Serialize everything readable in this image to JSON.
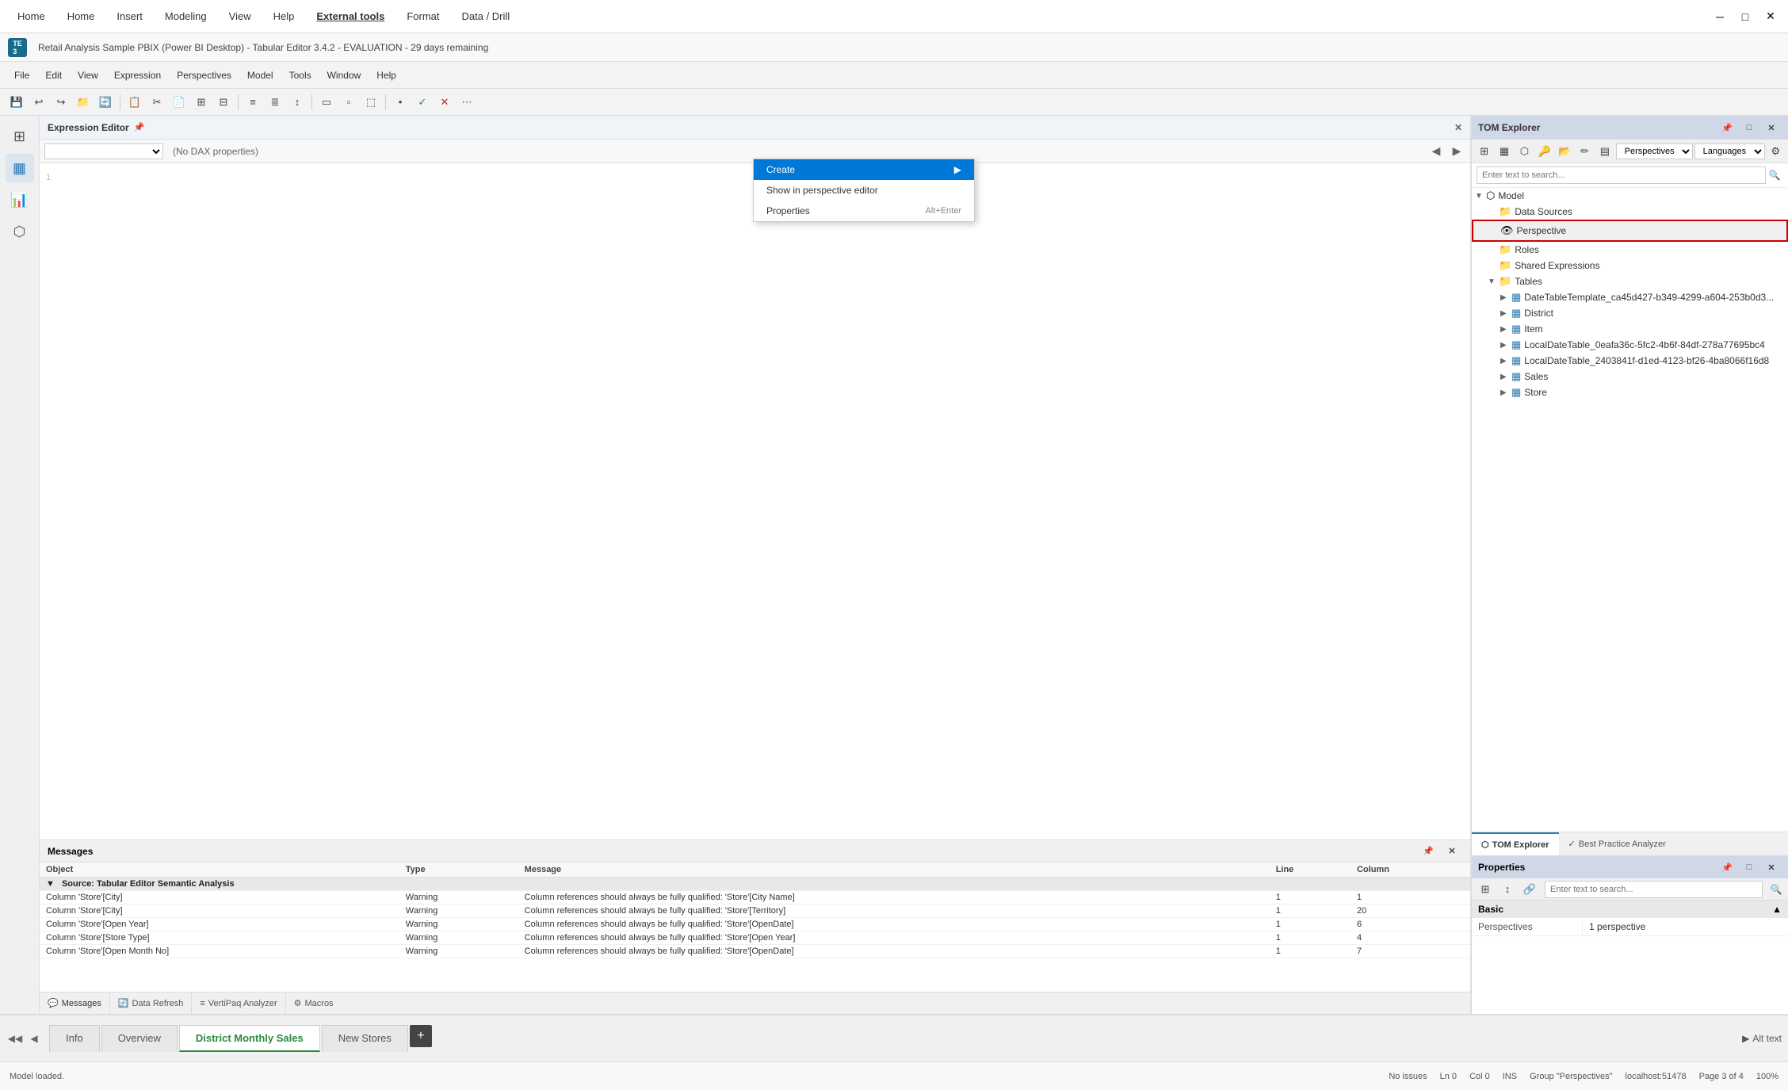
{
  "app": {
    "title": "Retail Analysis Sample PBIX (Power BI Desktop) - Tabular Editor 3.4.2 - EVALUATION - 29 days remaining",
    "tab_label": "Tabular Editor 3"
  },
  "powerbi_menu": {
    "items": [
      "Home",
      "Insert",
      "Modeling",
      "View",
      "Help",
      "External tools",
      "Format",
      "Data / Drill"
    ]
  },
  "tabular_menu": {
    "items": [
      "File",
      "Edit",
      "View",
      "Expression",
      "Perspectives",
      "Model",
      "Tools",
      "Window",
      "Help"
    ]
  },
  "expression_editor": {
    "title": "Expression Editor",
    "placeholder": "(No DAX properties)",
    "dropdown_value": ""
  },
  "tom_explorer": {
    "title": "TOM Explorer",
    "search_placeholder": "Enter text to search...",
    "perspectives_label": "Perspectives",
    "languages_label": "Languages",
    "tree": {
      "model_label": "Model",
      "data_sources_label": "Data Sources",
      "perspectives_label": "Perspectives",
      "roles_label": "Roles",
      "shared_label": "Shared Expressions",
      "tables_label": "Tables",
      "tables": [
        "DateTableTemplate_ca45d427-b349-4299-a604-253b0d3...",
        "District",
        "Item",
        "LocalDateTable_0eafa36c-5fc2-4b6f-84df-278a77695bc4",
        "LocalDateTable_2403841f-d1ed-4123-bf26-4ba8066f16d8",
        "Sales",
        "Store"
      ]
    }
  },
  "context_menu": {
    "perspective_label": "Perspective",
    "items": [
      {
        "label": "Create",
        "has_submenu": true
      },
      {
        "label": "Show in perspective editor",
        "has_submenu": false
      },
      {
        "label": "Properties",
        "shortcut": "Alt+Enter",
        "has_submenu": false
      }
    ]
  },
  "properties": {
    "title": "Properties",
    "basic_label": "Basic",
    "rows": [
      {
        "key": "Perspectives",
        "value": "1 perspective"
      }
    ]
  },
  "messages": {
    "title": "Messages",
    "columns": [
      "Object",
      "Type",
      "Message",
      "Line",
      "Column"
    ],
    "source_label": "Source: Tabular Editor Semantic Analysis",
    "rows": [
      {
        "object": "Column 'Store'[City]",
        "type": "Warning",
        "message": "Column references should always be fully qualified: 'Store'[City Name]",
        "line": "1",
        "col": "1"
      },
      {
        "object": "Column 'Store'[City]",
        "type": "Warning",
        "message": "Column references should always be fully qualified: 'Store'[Territory]",
        "line": "1",
        "col": "20"
      },
      {
        "object": "Column 'Store'[Open Year]",
        "type": "Warning",
        "message": "Column references should always be fully qualified: 'Store'[OpenDate]",
        "line": "1",
        "col": "6"
      },
      {
        "object": "Column 'Store'[Store Type]",
        "type": "Warning",
        "message": "Column references should always be fully qualified: 'Store'[Open Year]",
        "line": "1",
        "col": "4"
      },
      {
        "object": "Column 'Store'[Open Month No]",
        "type": "Warning",
        "message": "Column references should always be fully qualified: 'Store'[OpenDate]",
        "line": "1",
        "col": "7"
      }
    ]
  },
  "bottom_tabs": {
    "tabs": [
      {
        "label": "Messages",
        "icon": "💬"
      },
      {
        "label": "Data Refresh",
        "icon": "🔄"
      },
      {
        "label": "VertiPaq Analyzer",
        "icon": "📊"
      },
      {
        "label": "Macros",
        "icon": "⚙"
      }
    ]
  },
  "tom_bottom_tabs": [
    {
      "label": "TOM Explorer",
      "active": true
    },
    {
      "label": "Best Practice Analyzer",
      "active": false
    }
  ],
  "page_tabs": {
    "tabs": [
      {
        "label": "Info",
        "active": false
      },
      {
        "label": "Overview",
        "active": false
      },
      {
        "label": "District Monthly Sales",
        "active": true
      },
      {
        "label": "New Stores",
        "active": false
      }
    ],
    "add_label": "+"
  },
  "status_bar": {
    "left": "Model loaded.",
    "issues": "No issues",
    "ln": "Ln 0",
    "col": "Col 0",
    "ins": "INS",
    "group": "Group \"Perspectives\"",
    "server": "localhost:51478",
    "page_info": "Page 3 of 4",
    "zoom": "100%",
    "alt_text": "Alt text"
  }
}
